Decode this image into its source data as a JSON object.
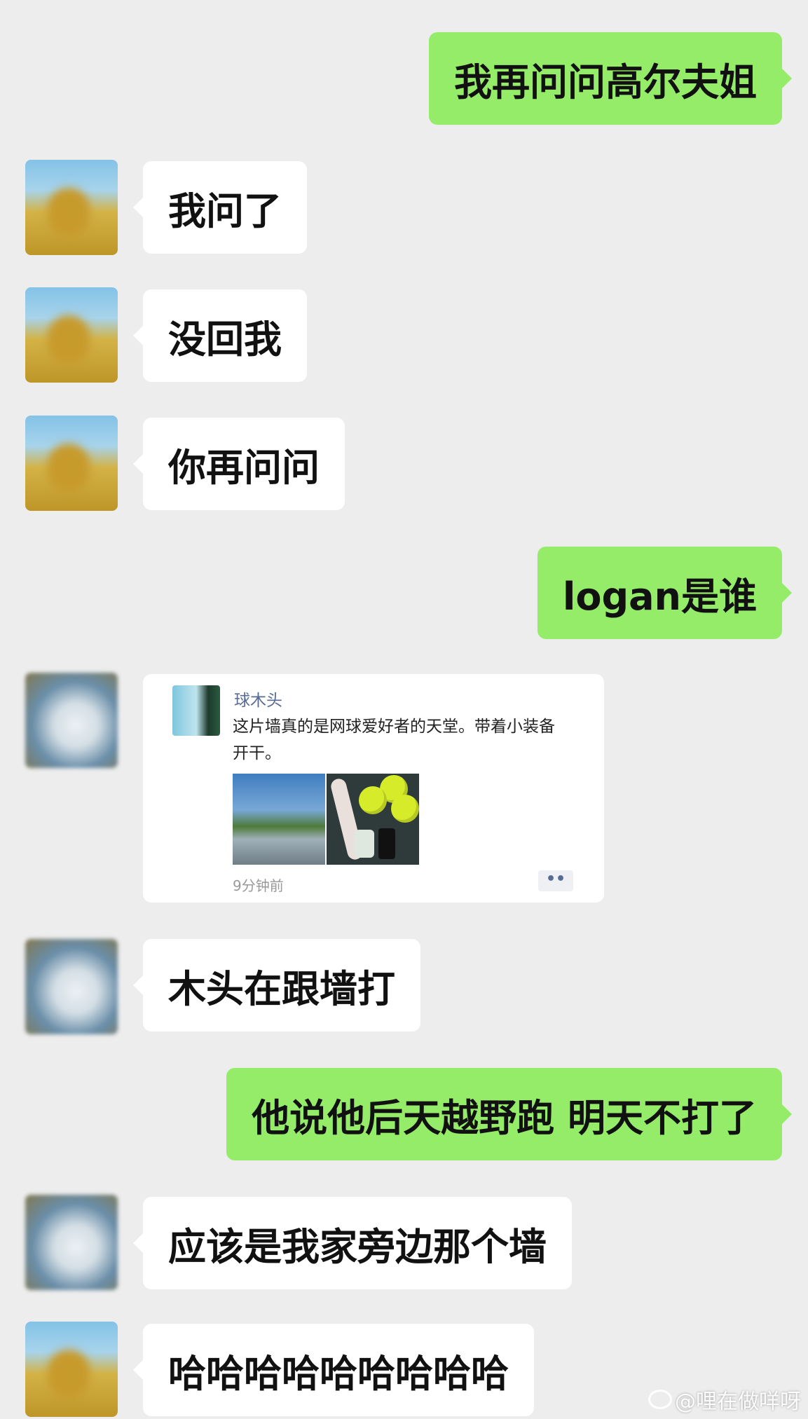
{
  "messages": [
    {
      "side": "out",
      "text": "我再问问高尔夫姐"
    },
    {
      "side": "in",
      "text": "我问了"
    },
    {
      "side": "in",
      "text": "没回我"
    },
    {
      "side": "in",
      "text": "你再问问"
    },
    {
      "side": "out",
      "text": "logan是谁"
    },
    {
      "side": "in",
      "text": "木头在跟墙打"
    },
    {
      "side": "out",
      "text": "他说他后天越野跑 明天不打了"
    },
    {
      "side": "in",
      "text": "应该是我家旁边那个墙"
    },
    {
      "side": "in",
      "text": "哈哈哈哈哈哈哈哈哈"
    }
  ],
  "moment_card": {
    "username": "球木头",
    "text": "这片墙真的是网球爱好者的天堂。带着小装备开干。",
    "time": "9分钟前",
    "more": "••"
  },
  "watermark": "@哩在做咩呀"
}
